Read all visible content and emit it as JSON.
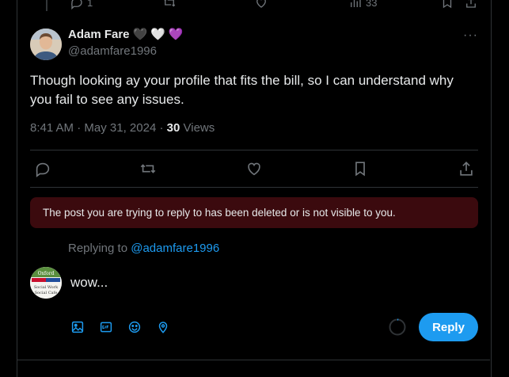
{
  "top_actions": {
    "views_count": "33",
    "replies_count": "1"
  },
  "tweet": {
    "author_name": "Adam Fare",
    "hearts": [
      "🖤",
      "🤍",
      "💜"
    ],
    "handle": "@adamfare1996",
    "text": "Though looking ay your profile that fits the bill, so I can understand why you fail to see any issues.",
    "time": "8:41 AM",
    "date": "May 31, 2024",
    "views": "30",
    "views_label": "Views",
    "more_label": "···"
  },
  "notice": {
    "text": "The post you are trying to reply to has been deleted or is not visible to you."
  },
  "reply": {
    "replying_prefix": "Replying to",
    "replying_handle": "@adamfare1996",
    "draft_text": "wow...",
    "button_label": "Reply",
    "avatar_text": [
      "Oxford",
      "Social Work",
      "Social Cafe"
    ]
  },
  "icons": {
    "actions": [
      "reply-icon",
      "repost-icon",
      "like-icon",
      "bookmark-icon",
      "share-icon"
    ],
    "tools": [
      "image-icon",
      "gif-icon",
      "emoji-icon",
      "location-icon"
    ]
  },
  "colors": {
    "accent": "#1d9bf0",
    "muted": "#71767b",
    "notice_bg": "#3b0a0e",
    "border": "#2f3336"
  }
}
